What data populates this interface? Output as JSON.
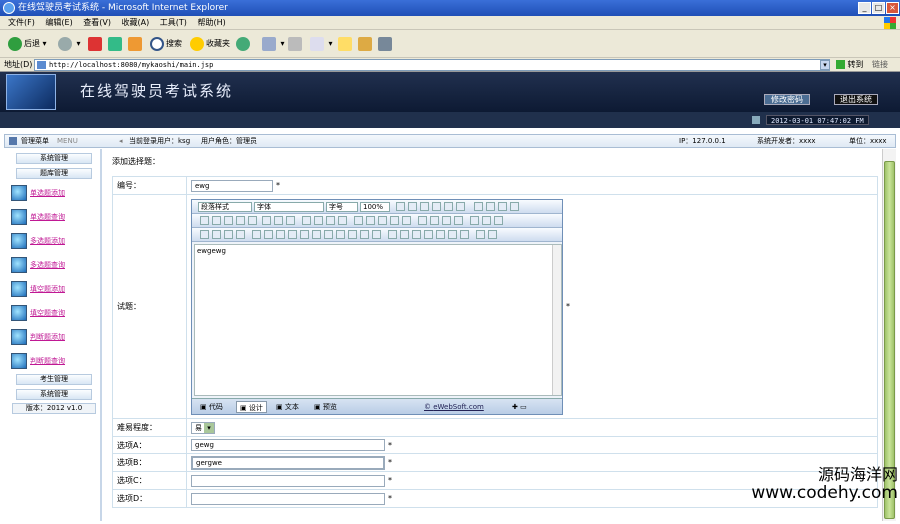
{
  "window": {
    "title": "在线驾驶员考试系统 - Microsoft Internet Explorer"
  },
  "menu": [
    "文件(F)",
    "编辑(E)",
    "查看(V)",
    "收藏(A)",
    "工具(T)",
    "帮助(H)"
  ],
  "toolbar": {
    "back": "后退",
    "search": "搜索",
    "favorites": "收藏夹"
  },
  "address": {
    "label": "地址(D)",
    "url": "http://localhost:8080/mykaoshi/main.jsp",
    "go": "转到",
    "links": "链接"
  },
  "banner": {
    "title": "在线驾驶员考试系统",
    "edit_pwd": "修改密码",
    "logout": "退出系统"
  },
  "strip": {
    "datetime": "2012-03-01 07:47:02 FM"
  },
  "infobar": {
    "menu_label": "管理菜单",
    "menu_sub": "MENU",
    "current_user": "当前登录用户：ksg",
    "user_role": "用户角色：管理员",
    "ip": "IP：127.0.0.1",
    "developer": "系统开发者：xxxx",
    "unit": "单位：xxxx"
  },
  "sidebar": {
    "sys_manage": "系统管理",
    "question_bank": "题库管理",
    "items": [
      "单选题添加",
      "单选题查询",
      "多选题添加",
      "多选题查询",
      "填空题添加",
      "填空题查询",
      "判断题添加",
      "判断题查询"
    ],
    "exam_manage": "考生管理",
    "sys_manage2": "系统管理",
    "version": "版本：2012 v1.0"
  },
  "form": {
    "section_title": "添加选择题：",
    "number_label": "编号：",
    "number_value": "ewg",
    "question_label": "试题：",
    "question_text": "ewgewg",
    "difficulty_label": "难易程度：",
    "difficulty_value": "易",
    "optA_label": "选项A：",
    "optA_value": "gewg",
    "optB_label": "选项B：",
    "optB_value": "gergwe",
    "optC_label": "选项C：",
    "optD_label": "选项D：",
    "star": "*"
  },
  "editor": {
    "para_style": "段落样式",
    "font": "字体",
    "size": "字号",
    "zoom": "100%",
    "tab_code": "代码",
    "tab_design": "设计",
    "tab_text": "文本",
    "tab_preview": "预览",
    "credit": "eWebSoft.com"
  },
  "watermark": {
    "line1": "源码海洋网",
    "line2": "www.codehy.com"
  }
}
